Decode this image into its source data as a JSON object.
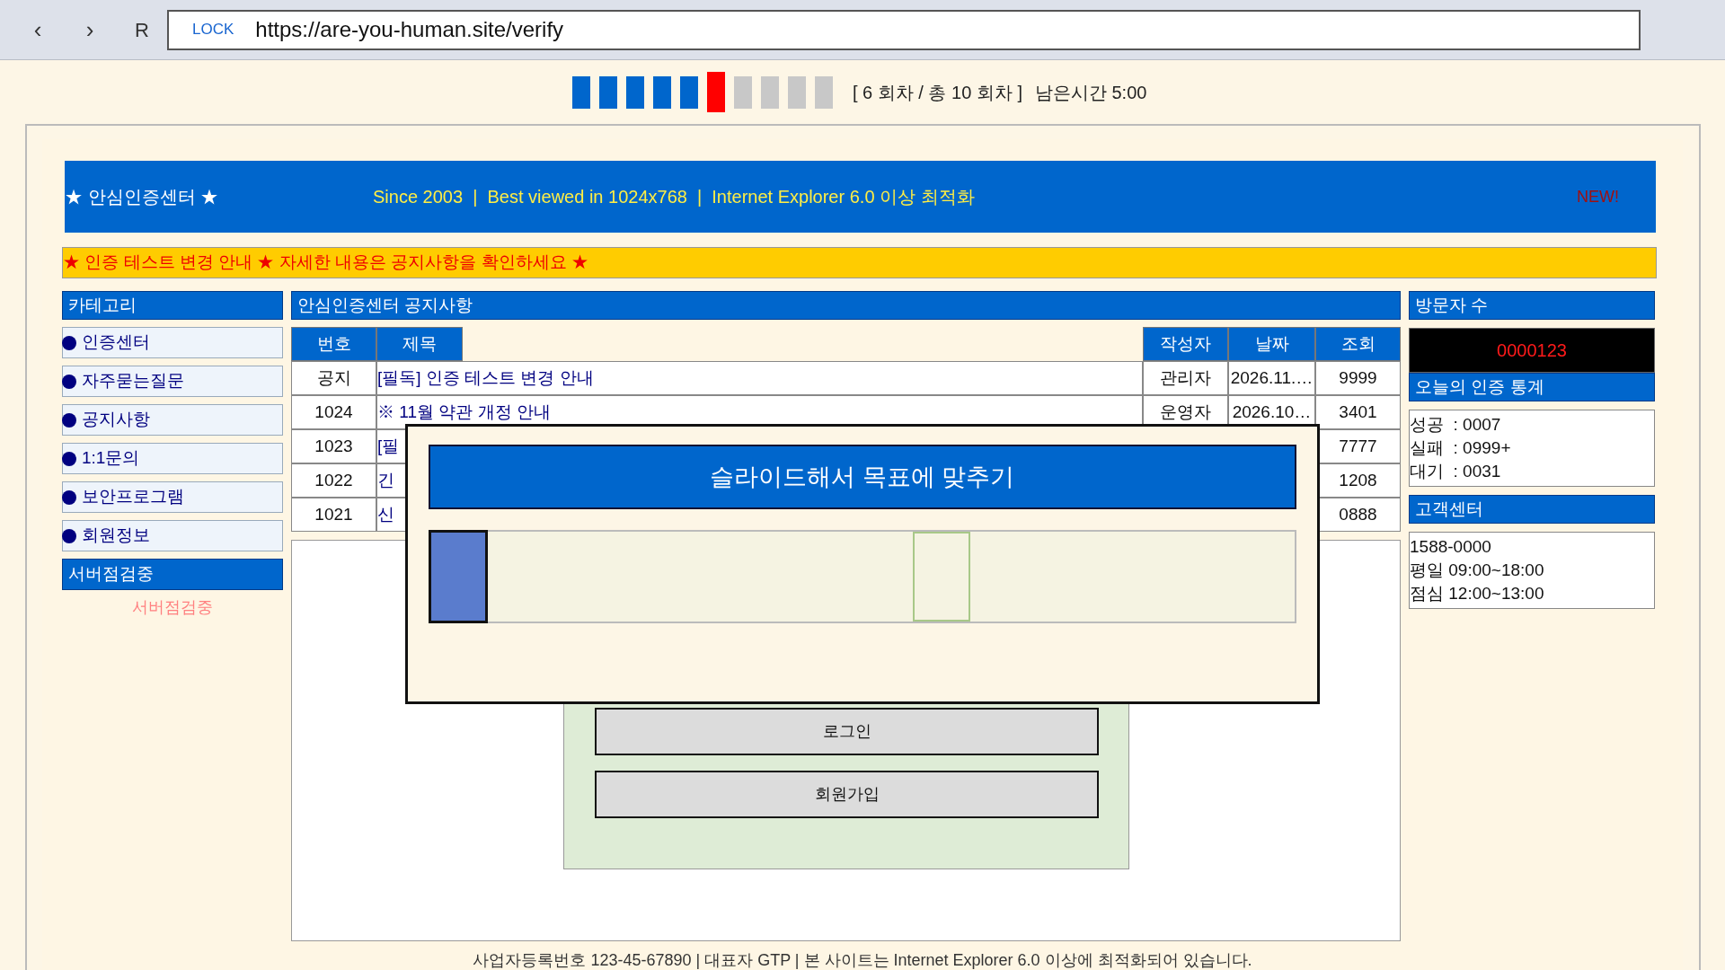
{
  "browser": {
    "back": "‹",
    "forward": "›",
    "reload": "R",
    "lock": "LOCK",
    "url": "https://are-you-human.site/verify"
  },
  "progress": {
    "steps": [
      {
        "kind": "done"
      },
      {
        "kind": "done"
      },
      {
        "kind": "done"
      },
      {
        "kind": "done"
      },
      {
        "kind": "done"
      },
      {
        "kind": "current"
      },
      {
        "kind": "pending"
      },
      {
        "kind": "pending"
      },
      {
        "kind": "pending"
      },
      {
        "kind": "pending"
      }
    ],
    "round_text": "[ 6 회차 / 총 10 회차 ]",
    "time_left": "남은시간 5:00"
  },
  "header": {
    "title": "★ 안심인증센터 ★",
    "tagline": "Since 2003  |  Best viewed in 1024x768  |  Internet Explorer 6.0 이상 최적화",
    "badge": "NEW!"
  },
  "ticker": "★ 인증 테스트 변경 안내 ★ 자세한 내용은 공지사항을 확인하세요 ★",
  "sidebar": {
    "title": "카테고리",
    "items": [
      {
        "label": "인증센터",
        "selected": false
      },
      {
        "label": "자주묻는질문",
        "selected": false
      },
      {
        "label": "공지사항",
        "selected": false
      },
      {
        "label": "1:1문의",
        "selected": false
      },
      {
        "label": "보안프로그램",
        "selected": false
      },
      {
        "label": "회원정보",
        "selected": false
      },
      {
        "label": "서버점검중",
        "selected": true
      }
    ],
    "status": "서버점검중"
  },
  "notice": {
    "title": "안심인증센터 공지사항",
    "columns": [
      "번호",
      "제목",
      "작성자",
      "날짜",
      "조회"
    ],
    "rows": [
      {
        "no": "공지",
        "title": "[필독] 인증 테스트 변경 안내",
        "author": "관리자",
        "date": "2026.11.…",
        "views": "9999"
      },
      {
        "no": "1024",
        "title": "※ 11월 약관 개정 안내",
        "author": "운영자",
        "date": "2026.10…",
        "views": "3401"
      },
      {
        "no": "1023",
        "title": "[필",
        "views": "7777"
      },
      {
        "no": "1022",
        "title": "긴",
        "views": "1208"
      },
      {
        "no": "1021",
        "title": "신",
        "views": "0888"
      }
    ],
    "buttons": [
      "로그인",
      "회원가입"
    ]
  },
  "visitors": {
    "title": "방문자 수",
    "count": "0000123"
  },
  "stats": {
    "title": "오늘의 인증 통계",
    "lines": [
      "성공  : 0007",
      "실패  : 0999+",
      "대기  : 0031"
    ]
  },
  "support": {
    "title": "고객센터",
    "lines": [
      "1588-0000",
      "평일 09:00~18:00",
      "점심 12:00~13:00"
    ]
  },
  "footer": "사업자등록번호 123-45-67890 | 대표자 GTP | 본 사이트는 Internet Explorer 6.0 이상에 최적화되어 있습니다.",
  "modal": {
    "title": "슬라이드해서 목표에 맞추기",
    "slider": {
      "level": 0
    }
  }
}
